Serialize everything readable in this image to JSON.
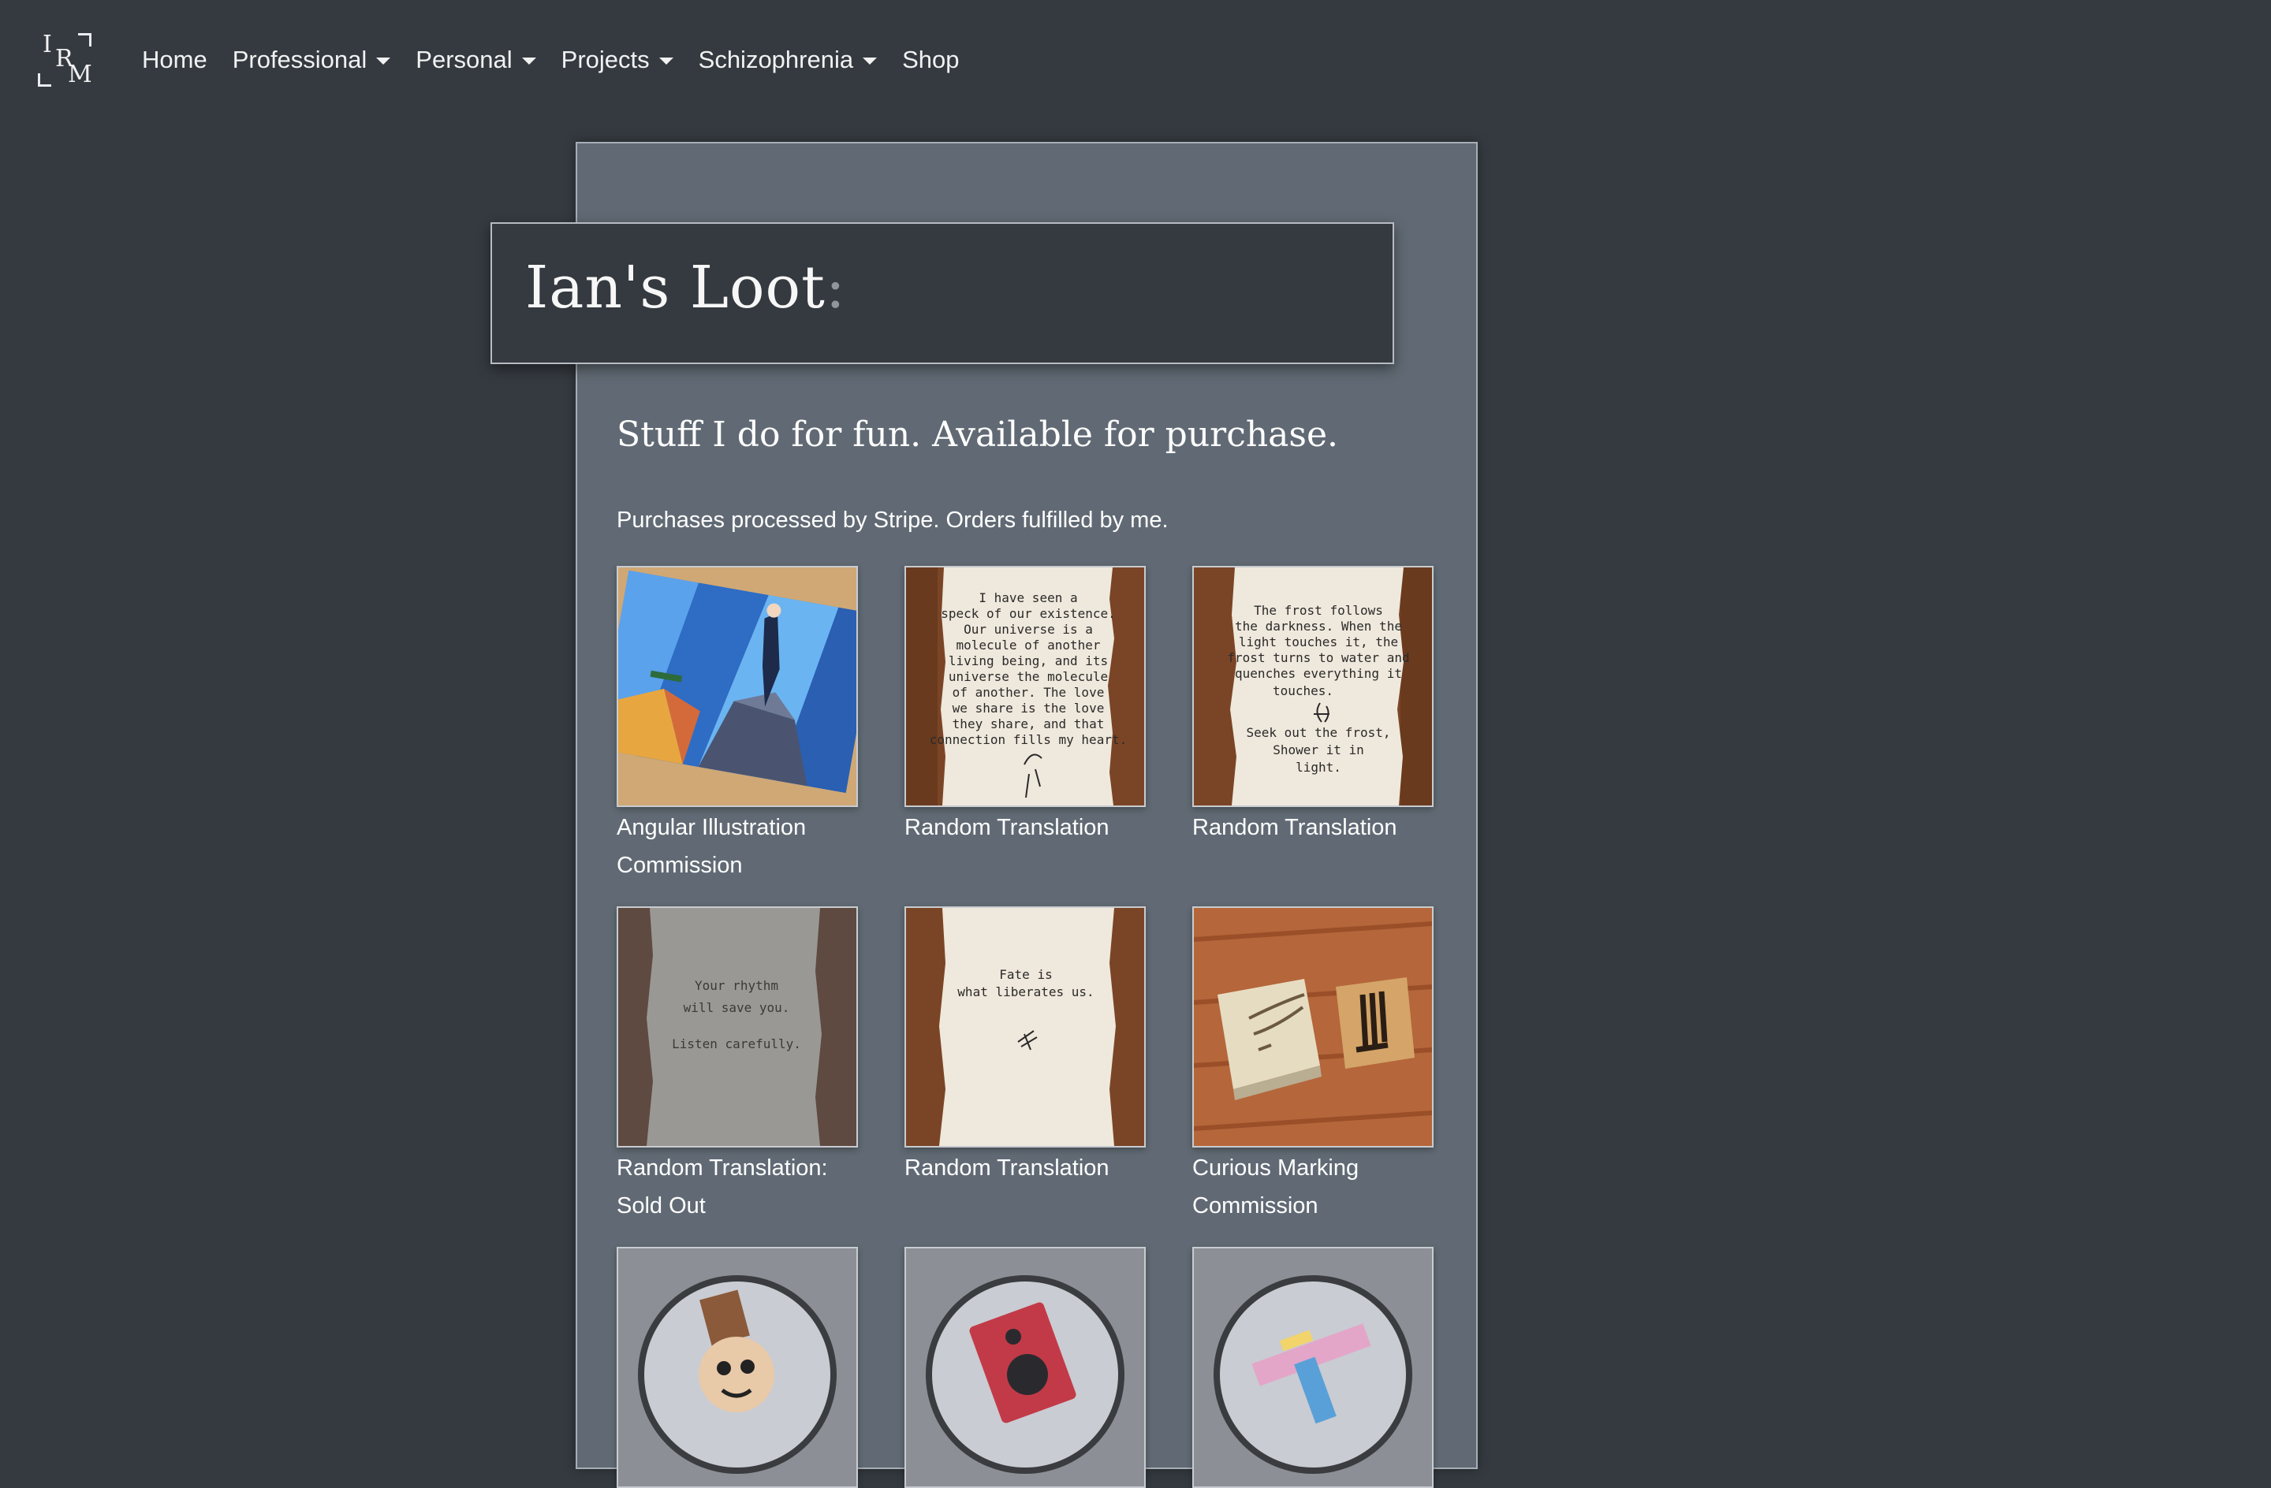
{
  "nav": {
    "logo_letters": [
      "I",
      "R",
      "M"
    ],
    "items": [
      {
        "label": "Home",
        "dropdown": false
      },
      {
        "label": "Professional",
        "dropdown": true
      },
      {
        "label": "Personal",
        "dropdown": true
      },
      {
        "label": "Projects",
        "dropdown": true
      },
      {
        "label": "Schizophrenia",
        "dropdown": true
      },
      {
        "label": "Shop",
        "dropdown": false
      }
    ]
  },
  "page": {
    "title": "Ian's Loot",
    "title_suffix": ":",
    "subtitle": "Stuff I do for fun. Available for purchase.",
    "note": "Purchases processed by Stripe. Orders fulfilled by me."
  },
  "products": [
    {
      "name": "Angular Illustration Commission",
      "image": "angular-illustration-image"
    },
    {
      "name": "Random Translation",
      "image": "handwritten-note-image",
      "image_text": [
        "I have seen a",
        "speck of our existence.",
        "Our universe is a",
        "molecule of another",
        "living being, and its",
        "universe the molecule",
        "of another. The love",
        "we share is the love",
        "they share, and that",
        "connection fills my heart."
      ]
    },
    {
      "name": "Random Translation",
      "image": "handwritten-note-image",
      "image_text": [
        "The frost follows",
        "the darkness. When the",
        "light touches it, the",
        "frost turns to water and",
        "quenches everything it",
        "touches.",
        "Seek out the frost,",
        "Shower it in",
        "light."
      ]
    },
    {
      "name": "Random Translation: Sold Out",
      "image": "handwritten-note-image",
      "image_text": [
        "Your rhythm",
        "will save you.",
        "Listen carefully."
      ]
    },
    {
      "name": "Random Translation",
      "image": "handwritten-note-image",
      "image_text": [
        "Fate is",
        "what liberates us."
      ]
    },
    {
      "name": "Curious Marking Commission",
      "image": "carved-blocks-image"
    },
    {
      "name": "",
      "image": "sticker-face-image"
    },
    {
      "name": "",
      "image": "sticker-speaker-image"
    },
    {
      "name": "",
      "image": "sticker-gun-image"
    }
  ],
  "colors": {
    "background": "#343a40",
    "card": "#616a74",
    "text": "#ffffff"
  }
}
